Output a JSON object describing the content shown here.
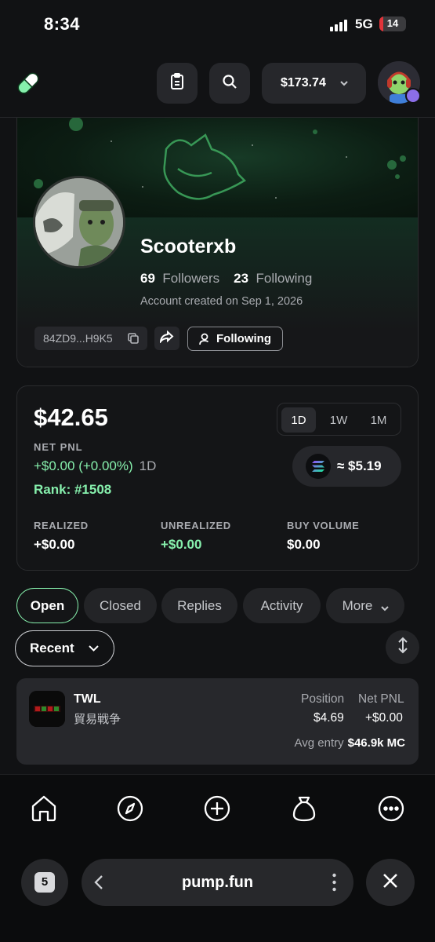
{
  "status_bar": {
    "time": "8:34",
    "network": "5G",
    "battery": "14",
    "battery_level": 0.14
  },
  "header": {
    "balance": "$173.74",
    "clipboard_icon": "clipboard-icon",
    "search_icon": "search-icon"
  },
  "profile": {
    "username": "Scooterxb",
    "followers_count": "69",
    "followers_label": "Followers",
    "following_count": "23",
    "following_label": "Following",
    "created": "Account created on Sep 1, 2026",
    "address": "84ZD9...H9K5",
    "follow_button": "Following"
  },
  "pnl": {
    "value": "$42.65",
    "net_pnl_label": "NET PNL",
    "change": "+$0.00 (+0.00%)",
    "change_period": "1D",
    "rank": "Rank: #1508",
    "periods": [
      "1D",
      "1W",
      "1M"
    ],
    "active_period": "1D",
    "sol_value": "≈ $5.19",
    "metrics": [
      {
        "label": "REALIZED",
        "value": "+$0.00"
      },
      {
        "label": "UNREALIZED",
        "value": "+$0.00"
      },
      {
        "label": "BUY VOLUME",
        "value": "$0.00"
      }
    ]
  },
  "tabs": [
    "Open",
    "Closed",
    "Replies",
    "Activity",
    "More"
  ],
  "active_tab": "Open",
  "filter": {
    "sort_label": "Recent"
  },
  "positions": [
    {
      "ticker": "TWL",
      "name": "貿易戦争",
      "position_label": "Position",
      "position_value": "$4.69",
      "pnl_label": "Net PNL",
      "pnl_value": "+$0.00",
      "avg_entry_label": "Avg entry",
      "avg_entry_value": "$46.9k MC"
    }
  ],
  "bottom_nav": [
    "home-icon",
    "compass-icon",
    "create-icon",
    "money-bag-icon",
    "more-icon"
  ],
  "browser": {
    "tab_count": "5",
    "url": "pump.fun"
  },
  "colors": {
    "accent_green": "#86efac",
    "background": "#111214",
    "surface": "#26272b"
  }
}
